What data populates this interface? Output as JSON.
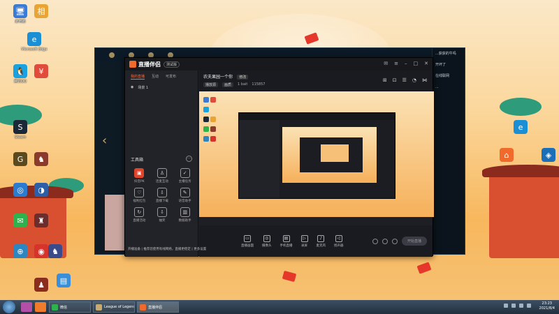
{
  "desktop": {
    "icons": [
      {
        "label": "此电脑",
        "glyph": "🖥",
        "color": "#3a7bd5"
      },
      {
        "label": "Microsoft Edge",
        "glyph": "e",
        "color": "#1b8fd6"
      },
      {
        "label": "腾讯QQ",
        "glyph": "🐧",
        "color": "#1aa1e0"
      },
      {
        "label": "Steam",
        "glyph": "S",
        "color": "#1b2838"
      },
      {
        "label": "",
        "glyph": "G",
        "color": "#5a4a1e"
      },
      {
        "label": "",
        "glyph": "♞",
        "color": "#8a3b2b"
      },
      {
        "label": "",
        "glyph": "◎",
        "color": "#2b7bd0"
      },
      {
        "label": "",
        "glyph": "◑",
        "color": "#2c5fa8"
      },
      {
        "label": "",
        "glyph": "✉",
        "color": "#2fb24e"
      },
      {
        "label": "",
        "glyph": "¥",
        "color": "#e04b3b"
      },
      {
        "label": "",
        "glyph": "相",
        "color": "#e8a535"
      },
      {
        "label": "",
        "glyph": "♜",
        "color": "#6c2d2d"
      },
      {
        "label": "",
        "glyph": "◉",
        "color": "#d6332a"
      },
      {
        "label": "",
        "glyph": "♟",
        "color": "#8a2d1e"
      },
      {
        "label": "",
        "glyph": "♞",
        "color": "#3a4a8a"
      },
      {
        "label": "",
        "glyph": "⊕",
        "color": "#2e86c1"
      },
      {
        "label": "",
        "glyph": "▤",
        "color": "#3a8fd8"
      },
      {
        "label": "",
        "glyph": "e",
        "color": "#1b8fd6"
      },
      {
        "label": "",
        "glyph": "⌂",
        "color": "#f06b2b"
      },
      {
        "label": "",
        "glyph": "◈",
        "color": "#1a6fb8"
      }
    ]
  },
  "lol_window": {
    "sidebar_text": [
      "...获获的牛吗",
      "开坏了",
      "在线联网",
      "..."
    ]
  },
  "app": {
    "name": "直播伴侣",
    "badge": "测试版",
    "left_tabs": [
      "我的直播",
      "互动",
      "可发布"
    ],
    "scene": "场景 1",
    "tools_title": "工具箱",
    "tools": [
      {
        "label": "抖音PK",
        "glyph": "▣",
        "hot": true
      },
      {
        "label": "连麦互动",
        "glyph": "♙",
        "hot": false
      },
      {
        "label": "主播任务",
        "glyph": "✓",
        "hot": false
      },
      {
        "label": "福利红包",
        "glyph": "♡",
        "hot": false
      },
      {
        "label": "直播下载",
        "glyph": "⇩",
        "hot": false
      },
      {
        "label": "语音助手",
        "glyph": "✎",
        "hot": false
      },
      {
        "label": "直播活动",
        "glyph": "↻",
        "hot": false
      },
      {
        "label": "抽奖",
        "glyph": "⇩",
        "hot": false
      },
      {
        "label": "数据助手",
        "glyph": "▥",
        "hot": false
      }
    ],
    "room_title": "农夫果园一个你",
    "room_edit": "修改",
    "room_meta": [
      "播放源",
      "画质",
      "1 bait",
      "115857"
    ],
    "preview_label": "",
    "bottom_items": [
      {
        "label": "直播画面",
        "glyph": "▭"
      },
      {
        "label": "摄像头",
        "glyph": "◎"
      },
      {
        "label": "手机直播",
        "glyph": "▤"
      },
      {
        "label": "录屏",
        "glyph": "▷"
      },
      {
        "label": "麦克风",
        "glyph": "♪"
      },
      {
        "label": "扬声器",
        "glyph": "◁"
      }
    ],
    "live_button": "开始直播",
    "status_text": "开播准备 | 推荐您使用有线网络，直播更稳定 | 更多设置"
  },
  "taskbar": {
    "tasks": [
      {
        "label": "微信",
        "color": "#2fb24e",
        "active": false
      },
      {
        "label": "League of Legends",
        "color": "#c8aa6e",
        "active": false
      },
      {
        "label": "直播伴侣",
        "color": "#f06b2b",
        "active": true
      }
    ],
    "clock_time": "23:23",
    "clock_date": "2021/8/4"
  }
}
